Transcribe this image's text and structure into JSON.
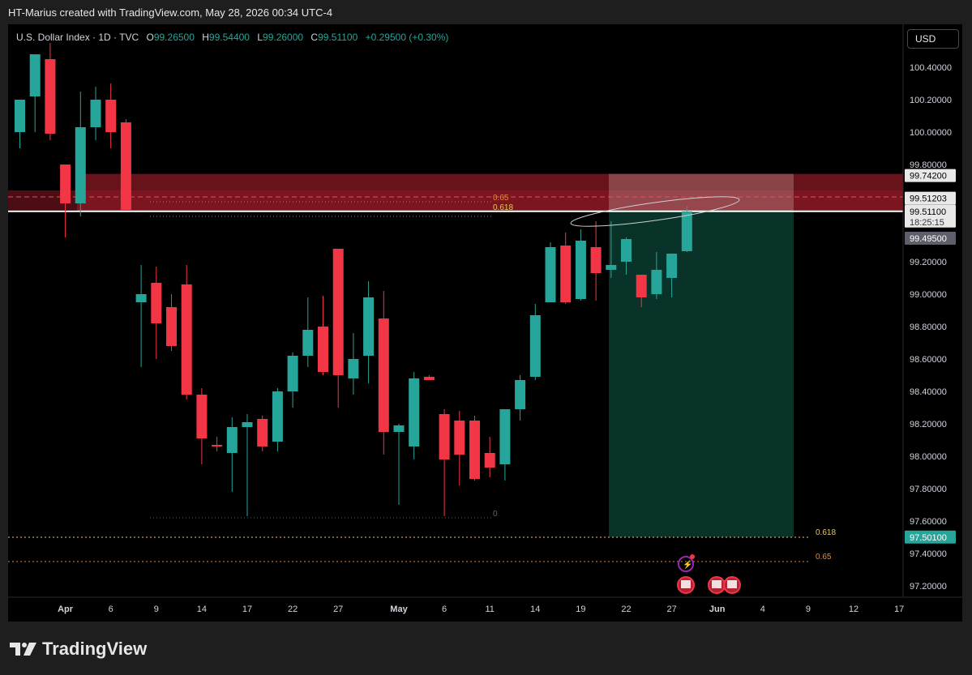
{
  "header": {
    "attribution": "HT-Marius created with TradingView.com, May 28, 2026 00:34 UTC-4"
  },
  "legend": {
    "symbol": "U.S. Dollar Index · 1D · TVC",
    "o_label": "O",
    "o_value": "99.26500",
    "h_label": "H",
    "h_value": "99.54400",
    "l_label": "L",
    "l_value": "99.26000",
    "c_label": "C",
    "c_value": "99.51100",
    "change": "+0.29500 (+0.30%)"
  },
  "currency_button": "USD",
  "footer": {
    "brand": "TradingView"
  },
  "colors": {
    "up": "#26a69a",
    "down": "#f23645",
    "bg": "#000000",
    "zone": "#8b1a24",
    "target_zone": "#0b3b30",
    "fib": "#e8c75a",
    "fib65": "#e08a3a"
  },
  "chart_data": {
    "type": "candlestick",
    "ylim": [
      97.1,
      100.55
    ],
    "y_ticks": [
      "100.40000",
      "100.20000",
      "100.00000",
      "99.80000",
      "99.20000",
      "99.00000",
      "98.80000",
      "98.60000",
      "98.40000",
      "98.20000",
      "98.00000",
      "97.80000",
      "97.60000",
      "97.40000",
      "97.20000"
    ],
    "y_tick_values": [
      100.4,
      100.2,
      100.0,
      99.8,
      99.2,
      99.0,
      98.8,
      98.6,
      98.4,
      98.2,
      98.0,
      97.8,
      97.6,
      97.4,
      97.2
    ],
    "x_ticks": [
      {
        "label": "Apr",
        "i": 3,
        "bold": true
      },
      {
        "label": "6",
        "i": 6
      },
      {
        "label": "9",
        "i": 9
      },
      {
        "label": "14",
        "i": 12
      },
      {
        "label": "17",
        "i": 15
      },
      {
        "label": "22",
        "i": 18
      },
      {
        "label": "27",
        "i": 21
      },
      {
        "label": "May",
        "i": 25,
        "bold": true
      },
      {
        "label": "6",
        "i": 28
      },
      {
        "label": "11",
        "i": 31
      },
      {
        "label": "14",
        "i": 34
      },
      {
        "label": "19",
        "i": 37
      },
      {
        "label": "22",
        "i": 40
      },
      {
        "label": "27",
        "i": 43
      },
      {
        "label": "Jun",
        "i": 46,
        "bold": true
      },
      {
        "label": "4",
        "i": 49
      },
      {
        "label": "9",
        "i": 52
      },
      {
        "label": "12",
        "i": 55
      },
      {
        "label": "17",
        "i": 58
      }
    ],
    "candles": [
      {
        "i": 0,
        "o": 100.0,
        "h": 100.15,
        "l": 99.9,
        "c": 100.2
      },
      {
        "i": 1,
        "o": 100.22,
        "h": 100.45,
        "l": 100.0,
        "c": 100.48
      },
      {
        "i": 2,
        "o": 100.45,
        "h": 100.55,
        "l": 99.95,
        "c": 99.99
      },
      {
        "i": 3,
        "o": 99.8,
        "h": 99.8,
        "l": 99.35,
        "c": 99.56
      },
      {
        "i": 4,
        "o": 99.56,
        "h": 100.25,
        "l": 99.48,
        "c": 100.03
      },
      {
        "i": 5,
        "o": 100.03,
        "h": 100.28,
        "l": 99.95,
        "c": 100.2
      },
      {
        "i": 6,
        "o": 100.2,
        "h": 100.3,
        "l": 99.9,
        "c": 100.0
      },
      {
        "i": 7,
        "o": 100.06,
        "h": 100.08,
        "l": 99.52,
        "c": 99.52
      },
      {
        "i": 8,
        "o": 98.95,
        "h": 99.18,
        "l": 98.55,
        "c": 99.0
      },
      {
        "i": 9,
        "o": 99.07,
        "h": 99.17,
        "l": 98.6,
        "c": 98.82
      },
      {
        "i": 10,
        "o": 98.92,
        "h": 99.0,
        "l": 98.65,
        "c": 98.68
      },
      {
        "i": 11,
        "o": 99.06,
        "h": 99.18,
        "l": 98.35,
        "c": 98.38
      },
      {
        "i": 12,
        "o": 98.38,
        "h": 98.42,
        "l": 97.95,
        "c": 98.11
      },
      {
        "i": 13,
        "o": 98.07,
        "h": 98.12,
        "l": 98.03,
        "c": 98.06
      },
      {
        "i": 14,
        "o": 98.02,
        "h": 98.24,
        "l": 97.78,
        "c": 98.18
      },
      {
        "i": 15,
        "o": 98.18,
        "h": 98.26,
        "l": 97.63,
        "c": 98.21
      },
      {
        "i": 16,
        "o": 98.23,
        "h": 98.25,
        "l": 98.03,
        "c": 98.06
      },
      {
        "i": 17,
        "o": 98.09,
        "h": 98.42,
        "l": 98.03,
        "c": 98.4
      },
      {
        "i": 18,
        "o": 98.4,
        "h": 98.64,
        "l": 98.3,
        "c": 98.62
      },
      {
        "i": 19,
        "o": 98.62,
        "h": 98.98,
        "l": 98.55,
        "c": 98.78
      },
      {
        "i": 20,
        "o": 98.8,
        "h": 98.99,
        "l": 98.5,
        "c": 98.52
      },
      {
        "i": 21,
        "o": 99.28,
        "h": 99.28,
        "l": 98.3,
        "c": 98.5
      },
      {
        "i": 22,
        "o": 98.48,
        "h": 98.76,
        "l": 98.38,
        "c": 98.6
      },
      {
        "i": 23,
        "o": 98.62,
        "h": 99.08,
        "l": 98.45,
        "c": 98.98
      },
      {
        "i": 24,
        "o": 98.85,
        "h": 99.02,
        "l": 98.01,
        "c": 98.15
      },
      {
        "i": 25,
        "o": 98.15,
        "h": 98.2,
        "l": 97.7,
        "c": 98.19
      },
      {
        "i": 26,
        "o": 98.06,
        "h": 98.52,
        "l": 97.98,
        "c": 98.48
      },
      {
        "i": 27,
        "o": 98.49,
        "h": 98.5,
        "l": 98.47,
        "c": 98.47
      },
      {
        "i": 28,
        "o": 98.26,
        "h": 98.29,
        "l": 97.63,
        "c": 97.98
      },
      {
        "i": 29,
        "o": 98.22,
        "h": 98.28,
        "l": 97.82,
        "c": 98.01
      },
      {
        "i": 30,
        "o": 98.22,
        "h": 98.25,
        "l": 97.85,
        "c": 97.86
      },
      {
        "i": 31,
        "o": 98.02,
        "h": 98.12,
        "l": 97.87,
        "c": 97.93
      },
      {
        "i": 32,
        "o": 97.95,
        "h": 98.27,
        "l": 97.85,
        "c": 98.29
      },
      {
        "i": 33,
        "o": 98.29,
        "h": 98.5,
        "l": 98.22,
        "c": 98.47
      },
      {
        "i": 34,
        "o": 98.49,
        "h": 98.94,
        "l": 98.47,
        "c": 98.87
      },
      {
        "i": 35,
        "o": 98.95,
        "h": 99.32,
        "l": 98.95,
        "c": 99.29
      },
      {
        "i": 36,
        "o": 99.3,
        "h": 99.38,
        "l": 98.94,
        "c": 98.95
      },
      {
        "i": 37,
        "o": 98.97,
        "h": 99.4,
        "l": 98.96,
        "c": 99.33
      },
      {
        "i": 38,
        "o": 99.29,
        "h": 99.45,
        "l": 98.96,
        "c": 99.13
      },
      {
        "i": 39,
        "o": 99.15,
        "h": 99.45,
        "l": 99.1,
        "c": 99.18
      },
      {
        "i": 40,
        "o": 99.2,
        "h": 99.35,
        "l": 99.12,
        "c": 99.34
      },
      {
        "i": 41,
        "o": 99.12,
        "h": 99.12,
        "l": 98.92,
        "c": 98.98
      },
      {
        "i": 42,
        "o": 99.0,
        "h": 99.26,
        "l": 98.97,
        "c": 99.15
      },
      {
        "i": 43,
        "o": 99.1,
        "h": 99.25,
        "l": 98.98,
        "c": 99.25
      },
      {
        "i": 44,
        "o": 99.265,
        "h": 99.544,
        "l": 99.26,
        "c": 99.511
      }
    ],
    "supply_zone": {
      "from": 99.51203,
      "to": 99.742
    },
    "target_zone": {
      "from": 97.501,
      "to": 99.511
    },
    "fib_upper": [
      {
        "label": "0.65",
        "value": 99.6
      },
      {
        "label": "0.618",
        "value": 99.51
      }
    ],
    "fib_lower": [
      {
        "label": "0",
        "value": 97.66
      },
      {
        "label": "0.618",
        "value": 97.52
      },
      {
        "label": "0.65",
        "value": 97.37
      }
    ],
    "price_tags": [
      {
        "text": "99.74200",
        "value": 99.742,
        "style": "light"
      },
      {
        "text": "99.51203",
        "value": 99.512,
        "style": "light"
      },
      {
        "text": "99.51100",
        "sub": "18:25:15",
        "value": 99.511,
        "style": "light"
      },
      {
        "text": "99.49500",
        "value": 99.495,
        "style": "grey"
      },
      {
        "text": "97.50100",
        "value": 97.501,
        "style": "green"
      }
    ]
  }
}
